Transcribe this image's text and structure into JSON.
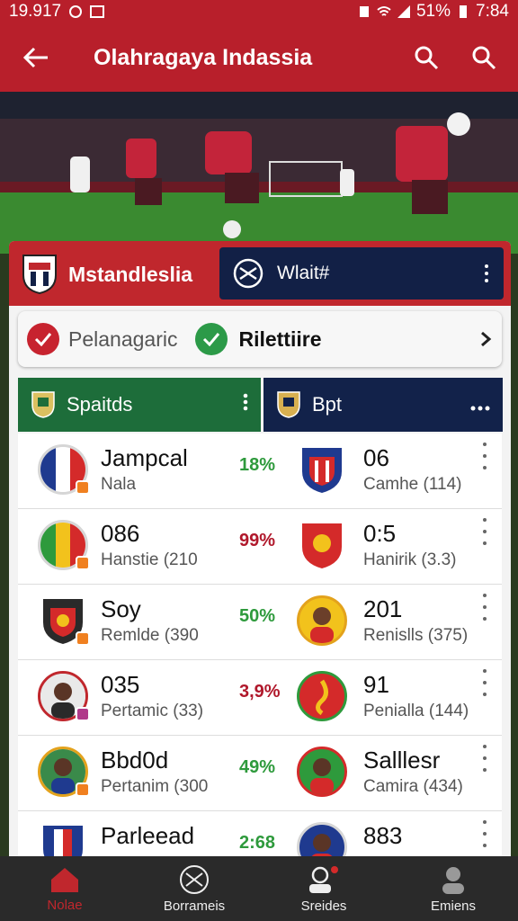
{
  "status": {
    "time_left": "19.917",
    "battery": "51%",
    "clock": "7:84"
  },
  "app_bar": {
    "title": "Olahragaya Indassia"
  },
  "team_tab": {
    "name": "Mstandleslia"
  },
  "match_tab": {
    "label": "Wlait#"
  },
  "filters": {
    "a": "Pelanagaric",
    "b": "Rilettiire"
  },
  "sections": {
    "left": "Spaitds",
    "right": "Bpt"
  },
  "rows": [
    {
      "left_name": "Jampcal",
      "left_sub": "Nala",
      "pct": "18%",
      "pct_color": "#2e9a3c",
      "right_name": "06",
      "right_sub": "Camhe (114)"
    },
    {
      "left_name": "086",
      "left_sub": "Hanstie (210",
      "pct": "99%",
      "pct_color": "#b0182b",
      "right_name": "0:5",
      "right_sub": "Hanirik (3.3)"
    },
    {
      "left_name": "Soy",
      "left_sub": "Remlde (390",
      "pct": "50%",
      "pct_color": "#2e9a3c",
      "right_name": "201",
      "right_sub": "Renislls (375)"
    },
    {
      "left_name": "035",
      "left_sub": "Pertamic (33)",
      "pct": "3,9%",
      "pct_color": "#b0182b",
      "right_name": "91",
      "right_sub": "Penialla (144)"
    },
    {
      "left_name": "Bbd0d",
      "left_sub": "Pertanim (300",
      "pct": "49%",
      "pct_color": "#2e9a3c",
      "right_name": "Salllesr",
      "right_sub": "Camira (434)"
    },
    {
      "left_name": "Parleead",
      "left_sub": "",
      "pct": "2:68",
      "pct_color": "#2e9a3c",
      "right_name": "883",
      "right_sub": ""
    }
  ],
  "nav": [
    {
      "label": "Nolae"
    },
    {
      "label": "Borrameis"
    },
    {
      "label": "Sreides"
    },
    {
      "label": "Emiens"
    }
  ],
  "colors": {
    "primary_red": "#b81f2b",
    "navy": "#122046",
    "green": "#1d6d3a"
  }
}
